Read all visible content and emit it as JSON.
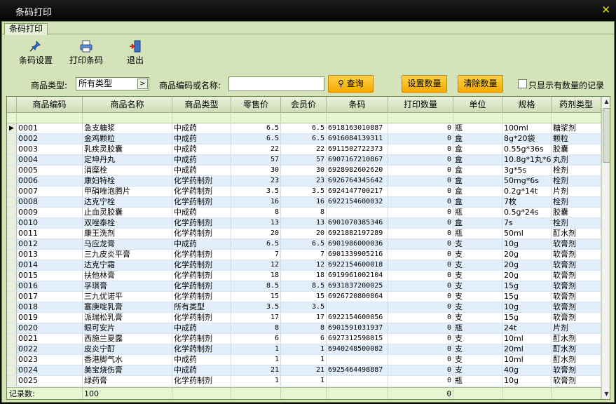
{
  "window": {
    "title": "条码打印",
    "close_glyph": "✕"
  },
  "tab": {
    "label": "条码打印"
  },
  "toolbar": {
    "barcode_settings": {
      "label": "条码设置",
      "icon": "pin-icon"
    },
    "print_barcode": {
      "label": "打印条码",
      "icon": "printer-icon"
    },
    "exit": {
      "label": "退出",
      "icon": "exit-door-icon"
    }
  },
  "filter": {
    "type_label": "商品类型:",
    "type_value": "所有类型",
    "code_name_label": "商品编码或名称:",
    "search_value": "",
    "query_label": "查询",
    "set_qty_label": "设置数量",
    "clear_qty_label": "清除数量",
    "only_qty_label": "只显示有数量的记录"
  },
  "grid": {
    "columns": [
      "商品编码",
      "商品名称",
      "商品类型",
      "零售价",
      "会员价",
      "条码",
      "打印数量",
      "单位",
      "规格",
      "药剂类型"
    ],
    "rows": [
      [
        "0001",
        "急支糖浆",
        "中成药",
        "6.5",
        "6.5",
        "6918163010887",
        "0",
        "瓶",
        "100ml",
        "糖浆剂"
      ],
      [
        "0002",
        "金鸡颗粒",
        "中成药",
        "6.5",
        "6.5",
        "6916084139311",
        "0",
        "盒",
        "8g*20袋",
        "颗粒"
      ],
      [
        "0003",
        "乳疾灵胶囊",
        "中成药",
        "22",
        "22",
        "6911502722373",
        "0",
        "盒",
        "0.55g*36s",
        "胶囊"
      ],
      [
        "0004",
        "定坤丹丸",
        "中成药",
        "57",
        "57",
        "6907167210867",
        "0",
        "盒",
        "10.8g*1丸*6",
        "丸剂"
      ],
      [
        "0005",
        "消糜栓",
        "中成药",
        "30",
        "30",
        "6928982602620",
        "0",
        "盒",
        "3g*5s",
        "栓剂"
      ],
      [
        "0006",
        "康妇特栓",
        "化学药制剂",
        "23",
        "23",
        "6926764345642",
        "0",
        "盒",
        "50mg*6s",
        "栓剂"
      ],
      [
        "0007",
        "甲硝唑泡腾片",
        "化学药制剂",
        "3.5",
        "3.5",
        "6924147700217",
        "0",
        "盒",
        "0.2g*14t",
        "片剂"
      ],
      [
        "0008",
        "达克宁栓",
        "化学药制剂",
        "16",
        "16",
        "6922154600032",
        "0",
        "盒",
        "7枚",
        "栓剂"
      ],
      [
        "0009",
        "止血灵胶囊",
        "中成药",
        "8",
        "8",
        "",
        "0",
        "瓶",
        "0.5g*24s",
        "胶囊"
      ],
      [
        "0010",
        "双唑泰栓",
        "化学药制剂",
        "13",
        "13",
        "6901070385346",
        "0",
        "盒",
        "7s",
        "栓剂"
      ],
      [
        "0011",
        "康王洗剂",
        "化学药制剂",
        "20",
        "20",
        "6921882197289",
        "0",
        "瓶",
        "50ml",
        "酊水剂"
      ],
      [
        "0012",
        "马应龙膏",
        "中成药",
        "6.5",
        "6.5",
        "6901986000036",
        "0",
        "支",
        "10g",
        "软膏剂"
      ],
      [
        "0013",
        "三九皮炎平膏",
        "化学药制剂",
        "7",
        "7",
        "6901339905216",
        "0",
        "支",
        "20g",
        "软膏剂"
      ],
      [
        "0014",
        "达克宁霜",
        "化学药制剂",
        "12",
        "12",
        "6922154600018",
        "0",
        "支",
        "20g",
        "软膏剂"
      ],
      [
        "0015",
        "扶他林膏",
        "化学药制剂",
        "18",
        "18",
        "6919961002104",
        "0",
        "支",
        "20g",
        "软膏剂"
      ],
      [
        "0016",
        "孚琪膏",
        "化学药制剂",
        "8.5",
        "8.5",
        "6931837200025",
        "0",
        "支",
        "15g",
        "软膏剂"
      ],
      [
        "0017",
        "三九优诺平",
        "化学药制剂",
        "15",
        "15",
        "6926720800864",
        "0",
        "支",
        "15g",
        "软膏剂"
      ],
      [
        "0018",
        "塞庚啶乳膏",
        "所有类型",
        "3.5",
        "3.5",
        "",
        "0",
        "支",
        "10g",
        "软膏剂"
      ],
      [
        "0019",
        "派瑞松乳膏",
        "化学药制剂",
        "17",
        "17",
        "6922154600056",
        "0",
        "支",
        "15g",
        "软膏剂"
      ],
      [
        "0020",
        "眼可安片",
        "中成药",
        "8",
        "8",
        "6901591031937",
        "0",
        "瓶",
        "24t",
        "片剂"
      ],
      [
        "0021",
        "西施兰夏露",
        "化学药制剂",
        "6",
        "6",
        "6927312598015",
        "0",
        "支",
        "10ml",
        "酊水剂"
      ],
      [
        "0022",
        "皮炎宁酊",
        "化学药制剂",
        "1",
        "1",
        "6940248500082",
        "0",
        "支",
        "20ml",
        "酊水剂"
      ],
      [
        "0023",
        "香港脚气水",
        "中成药",
        "1",
        "1",
        "",
        "0",
        "支",
        "10ml",
        "酊水剂"
      ],
      [
        "0024",
        "美宝烧伤膏",
        "中成药",
        "21",
        "21",
        "6925464498887",
        "0",
        "支",
        "40g",
        "软膏剂"
      ],
      [
        "0025",
        "绿药膏",
        "化学药制剂",
        "1",
        "1",
        "",
        "0",
        "瓶",
        "10g",
        "软膏剂"
      ]
    ],
    "current_row_marker": "▶",
    "footer": {
      "label": "记录数:",
      "count": "100",
      "qty_total": "0"
    }
  }
}
